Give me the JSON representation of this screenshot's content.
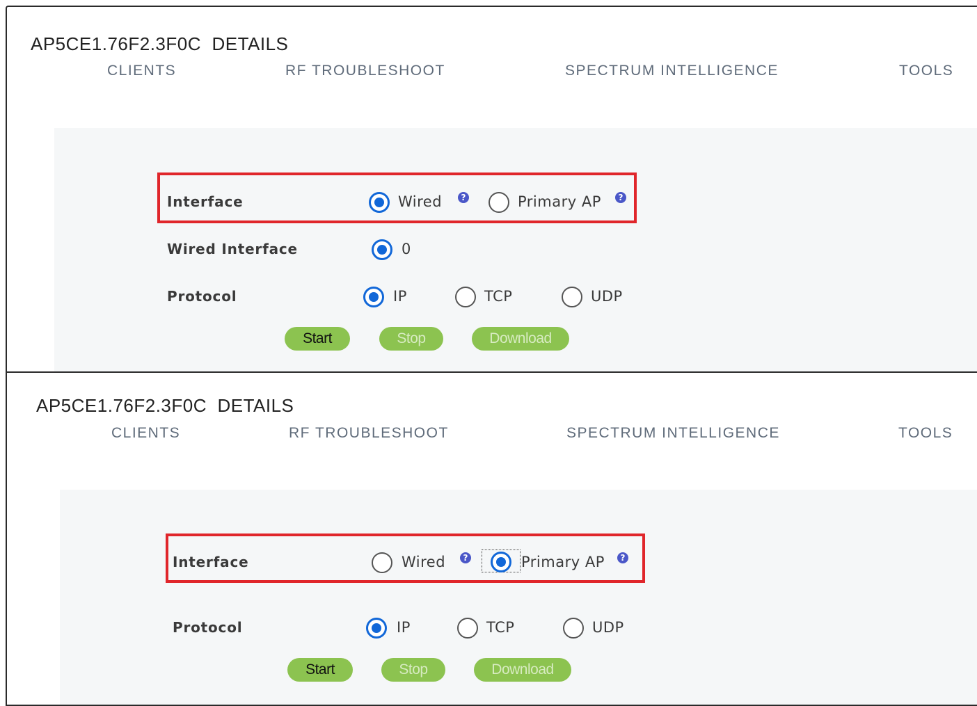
{
  "panels": [
    {
      "title": "AP5CE1.76F2.3F0C  DETAILS",
      "tabs": [
        "CLIENTS",
        "RF TROUBLESHOOT",
        "SPECTRUM INTELLIGENCE",
        "TOOLS"
      ],
      "interface": {
        "label": "Interface",
        "options": [
          {
            "label": "Wired",
            "checked": true
          },
          {
            "label": "Primary AP",
            "checked": false
          }
        ]
      },
      "wired_interface": {
        "label": "Wired Interface",
        "options": [
          {
            "label": "0",
            "checked": true
          }
        ]
      },
      "protocol": {
        "label": "Protocol",
        "options": [
          {
            "label": "IP",
            "checked": true
          },
          {
            "label": "TCP",
            "checked": false
          },
          {
            "label": "UDP",
            "checked": false
          }
        ]
      },
      "buttons": {
        "start": "Start",
        "stop": "Stop",
        "download": "Download"
      }
    },
    {
      "title": "AP5CE1.76F2.3F0C  DETAILS",
      "tabs": [
        "CLIENTS",
        "RF TROUBLESHOOT",
        "SPECTRUM INTELLIGENCE",
        "TOOLS"
      ],
      "interface": {
        "label": "Interface",
        "options": [
          {
            "label": "Wired",
            "checked": false
          },
          {
            "label": "Primary AP",
            "checked": true
          }
        ]
      },
      "protocol": {
        "label": "Protocol",
        "options": [
          {
            "label": "IP",
            "checked": true
          },
          {
            "label": "TCP",
            "checked": false
          },
          {
            "label": "UDP",
            "checked": false
          }
        ]
      },
      "buttons": {
        "start": "Start",
        "stop": "Stop",
        "download": "Download"
      }
    }
  ],
  "help_glyph": "?",
  "colors": {
    "accent": "#1167d8",
    "highlight": "#e0262b",
    "button": "#8cc350",
    "help": "#4a57c8"
  }
}
